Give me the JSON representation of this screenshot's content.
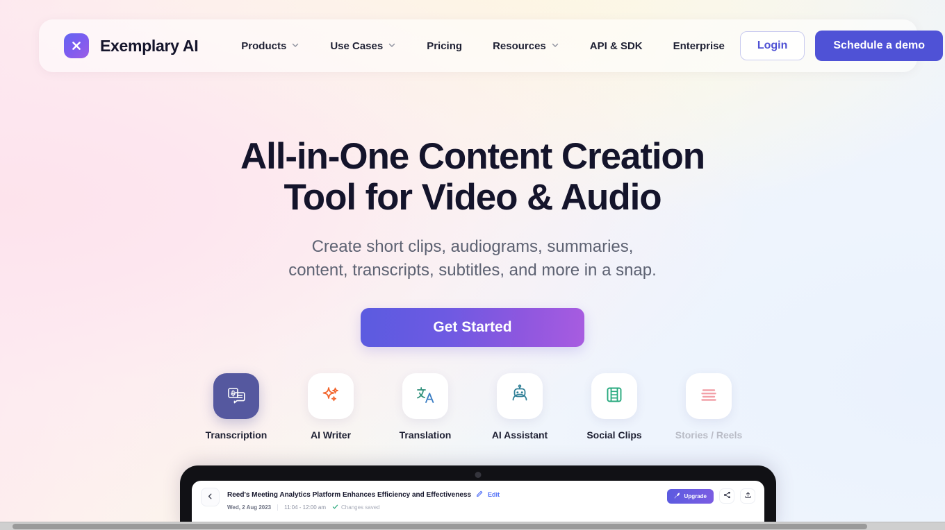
{
  "brand": {
    "name": "Exemplary AI",
    "logo_icon": "x-logo-icon",
    "logo_color": "#7c5cf0"
  },
  "nav": {
    "links": [
      {
        "label": "Products",
        "has_dropdown": true
      },
      {
        "label": "Use Cases",
        "has_dropdown": true
      },
      {
        "label": "Pricing",
        "has_dropdown": false
      },
      {
        "label": "Resources",
        "has_dropdown": true
      },
      {
        "label": "API & SDK",
        "has_dropdown": false
      },
      {
        "label": "Enterprise",
        "has_dropdown": false
      }
    ],
    "login_label": "Login",
    "demo_label": "Schedule a demo",
    "demo_color": "#4f52d6",
    "login_color": "#4f52d4"
  },
  "hero": {
    "title_line1": "All-in-One Content Creation",
    "title_line2": "Tool for Video & Audio",
    "subtitle_line1": "Create short clips, audiograms, summaries,",
    "subtitle_line2": "content, transcripts, subtitles, and more in a snap.",
    "cta_label": "Get Started",
    "cta_gradient_from": "#5b5be0",
    "cta_gradient_to": "#a85ce0"
  },
  "features": [
    {
      "label": "Transcription",
      "icon": "transcription-icon",
      "state": "active"
    },
    {
      "label": "AI Writer",
      "icon": "sparkles-icon",
      "state": "default"
    },
    {
      "label": "Translation",
      "icon": "translate-icon",
      "state": "default"
    },
    {
      "label": "AI Assistant",
      "icon": "robot-icon",
      "state": "default"
    },
    {
      "label": "Social Clips",
      "icon": "film-strip-icon",
      "state": "default"
    },
    {
      "label": "Stories / Reels",
      "icon": "stories-lines-icon",
      "state": "dimmed"
    }
  ],
  "preview": {
    "doc_title": "Reed's Meeting Analytics Platform Enhances Efficiency and Effectiveness",
    "edit_label": "Edit",
    "date": "Wed, 2 Aug 2023",
    "time_range": "11:04 - 12:00 am",
    "saved_status": "Changes saved",
    "upgrade_label": "Upgrade",
    "back_icon": "chevron-left-icon",
    "edit_icon": "pencil-icon",
    "check_icon": "check-icon",
    "upgrade_icon": "rocket-icon",
    "share_icon": "share-icon",
    "upload_icon": "upload-icon"
  }
}
